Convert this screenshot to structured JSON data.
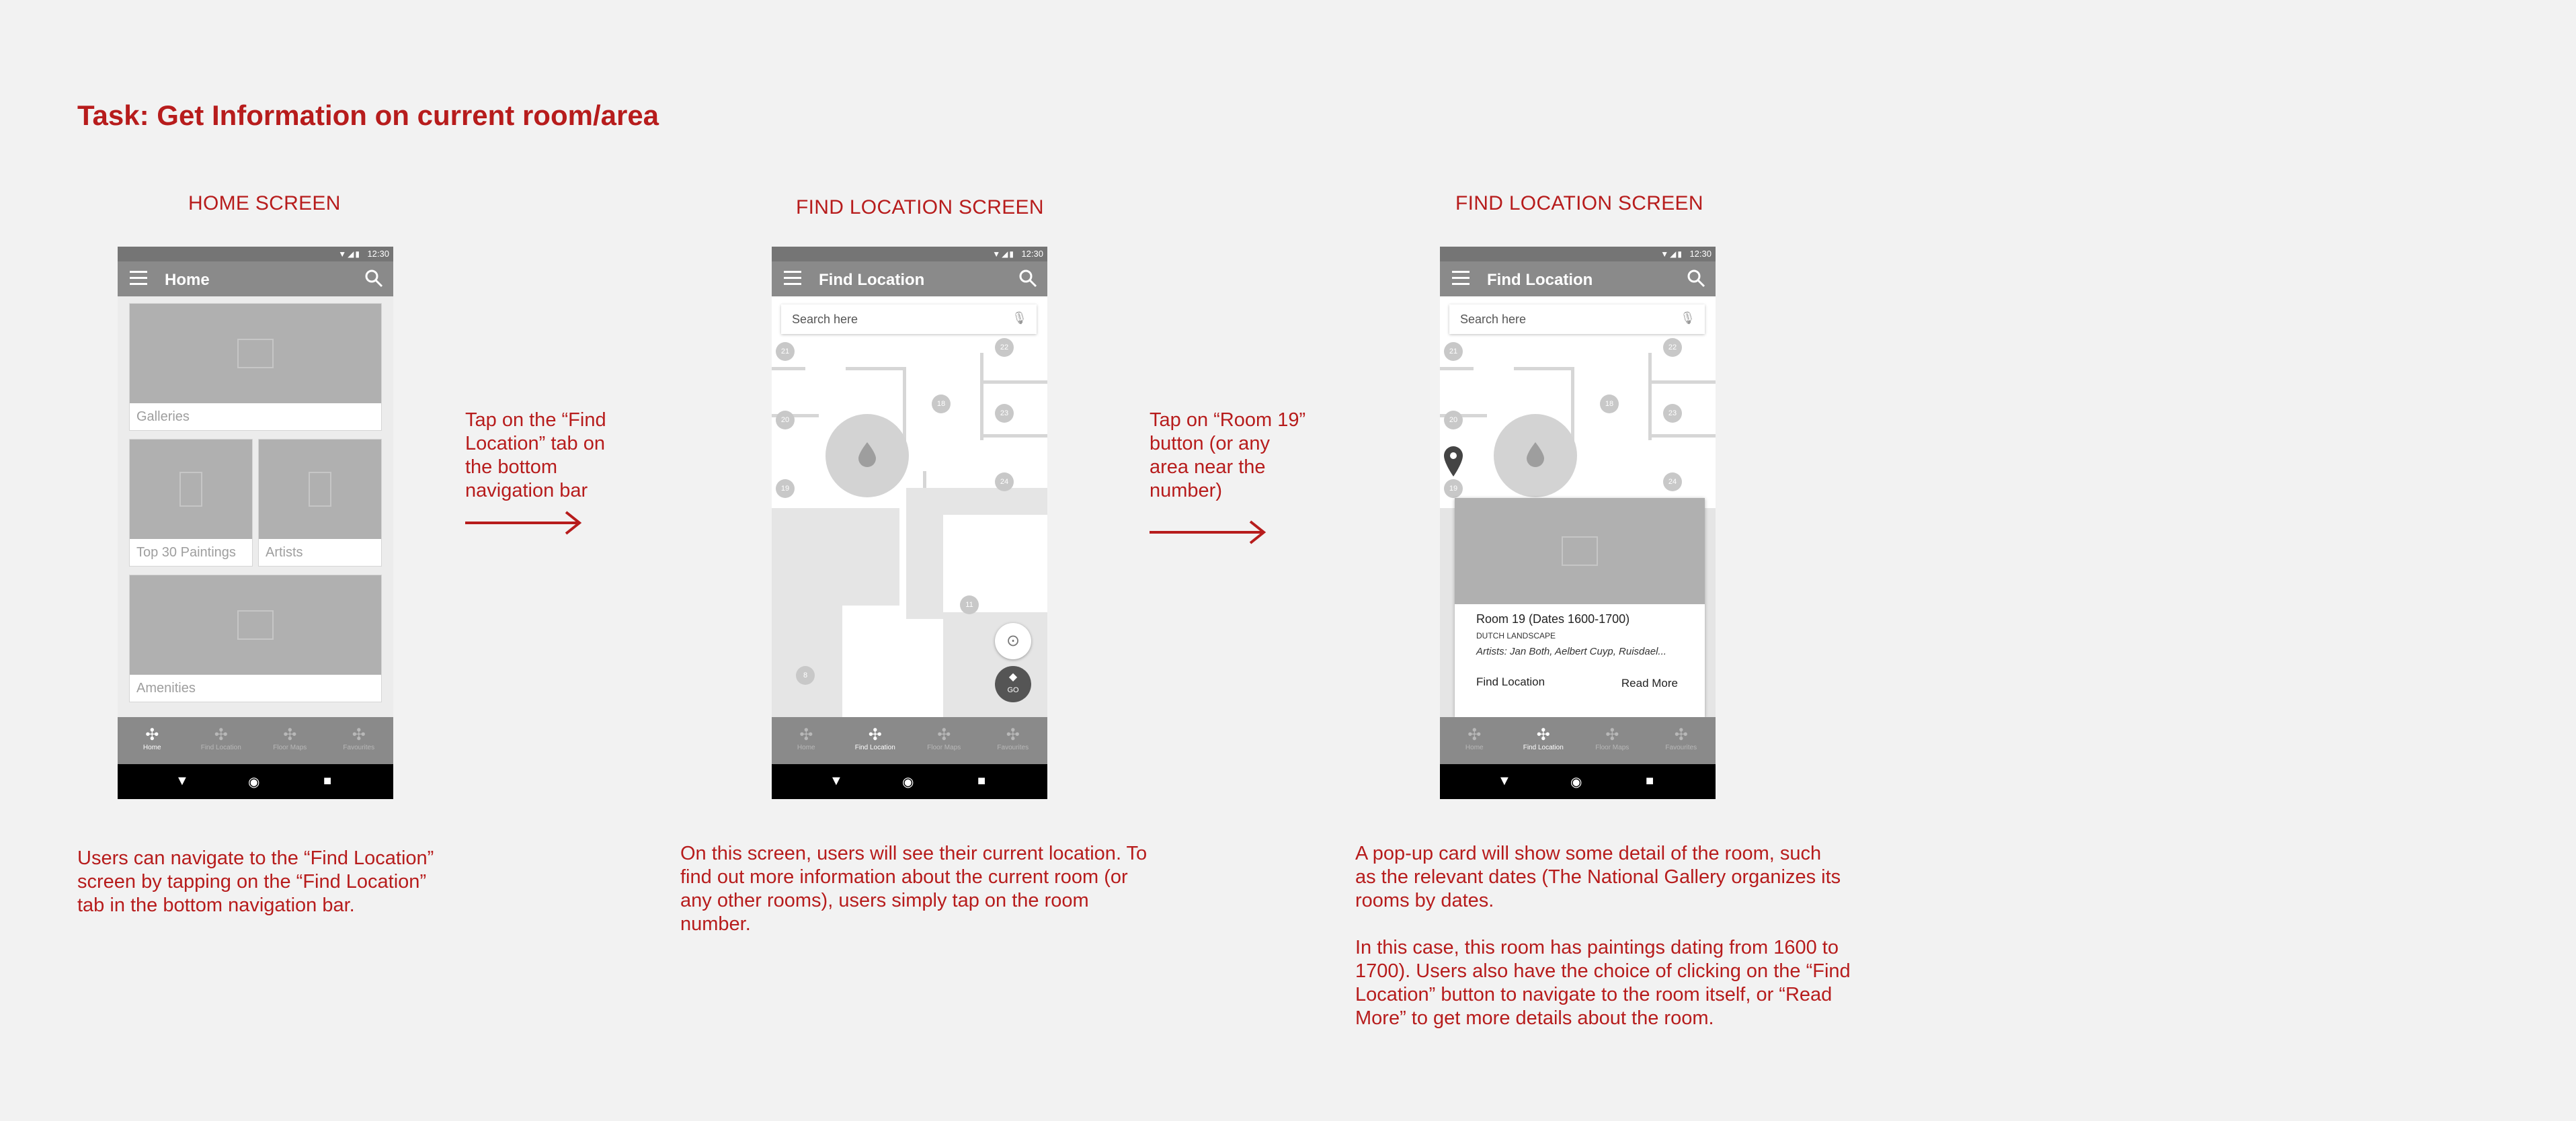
{
  "task_title": "Task: Get Information on current room/area",
  "screens": {
    "home_label": "HOME SCREEN",
    "find_label_1": "FIND LOCATION SCREEN",
    "find_label_2": "FIND LOCATION SCREEN"
  },
  "status_time": "12:30",
  "home": {
    "title": "Home",
    "cards": [
      "Galleries",
      "Top 30 Paintings",
      "Artists",
      "Amenities"
    ]
  },
  "find": {
    "title": "Find Location",
    "search_placeholder": "Search here",
    "fab_go": "GO",
    "rooms": [
      "21",
      "22",
      "19",
      "20",
      "23",
      "19",
      "24",
      "11",
      "8"
    ]
  },
  "bottom_nav": [
    "Home",
    "Find Location",
    "Floor Maps",
    "Favourites"
  ],
  "popup": {
    "room": "Room 19 (Dates 1600-1700)",
    "subtitle": "DUTCH LANDSCAPE",
    "artists": "Artists: Jan Both, Aelbert Cuyp, Ruisdael...",
    "find_button": "Find Location",
    "read_more_button": "Read More"
  },
  "instructions": {
    "step1": [
      "Tap on the “Find",
      "Location” tab on",
      "the bottom",
      "navigation bar"
    ],
    "step2": [
      "Tap on “Room 19”",
      "button (or any",
      "area near the",
      "number)"
    ]
  },
  "descriptions": {
    "home": [
      "Users can navigate to the “Find Location”",
      "screen by tapping on the “Find Location”",
      "tab in the bottom navigation bar."
    ],
    "find": [
      "On this screen, users will see their current location. To",
      "find out more information about the current room (or",
      "any other rooms), users simply tap on the room",
      "number."
    ],
    "popup_1": [
      "A pop-up card will show some detail of the room, such",
      "as the relevant dates (The National Gallery organizes its",
      "rooms by dates."
    ],
    "popup_2": [
      "In this case, this room has paintings dating from 1600 to",
      "1700). Users also have the choice of clicking on the “Find",
      "Location” button to navigate to the room itself, or “Read",
      "More” to get more details about the room."
    ]
  },
  "colors": {
    "accent": "#b71c1c",
    "appbar": "#8a8a8a",
    "statusbar": "#757575",
    "background": "#f2f2f2"
  },
  "icons": [
    "menu-icon",
    "search-icon",
    "wifi-icon",
    "signal-icon",
    "battery-icon",
    "image-placeholder-icon",
    "mic-icon",
    "map-pin-icon",
    "my-location-icon",
    "directions-icon",
    "back-triangle-icon",
    "home-circle-icon",
    "recents-square-icon"
  ]
}
